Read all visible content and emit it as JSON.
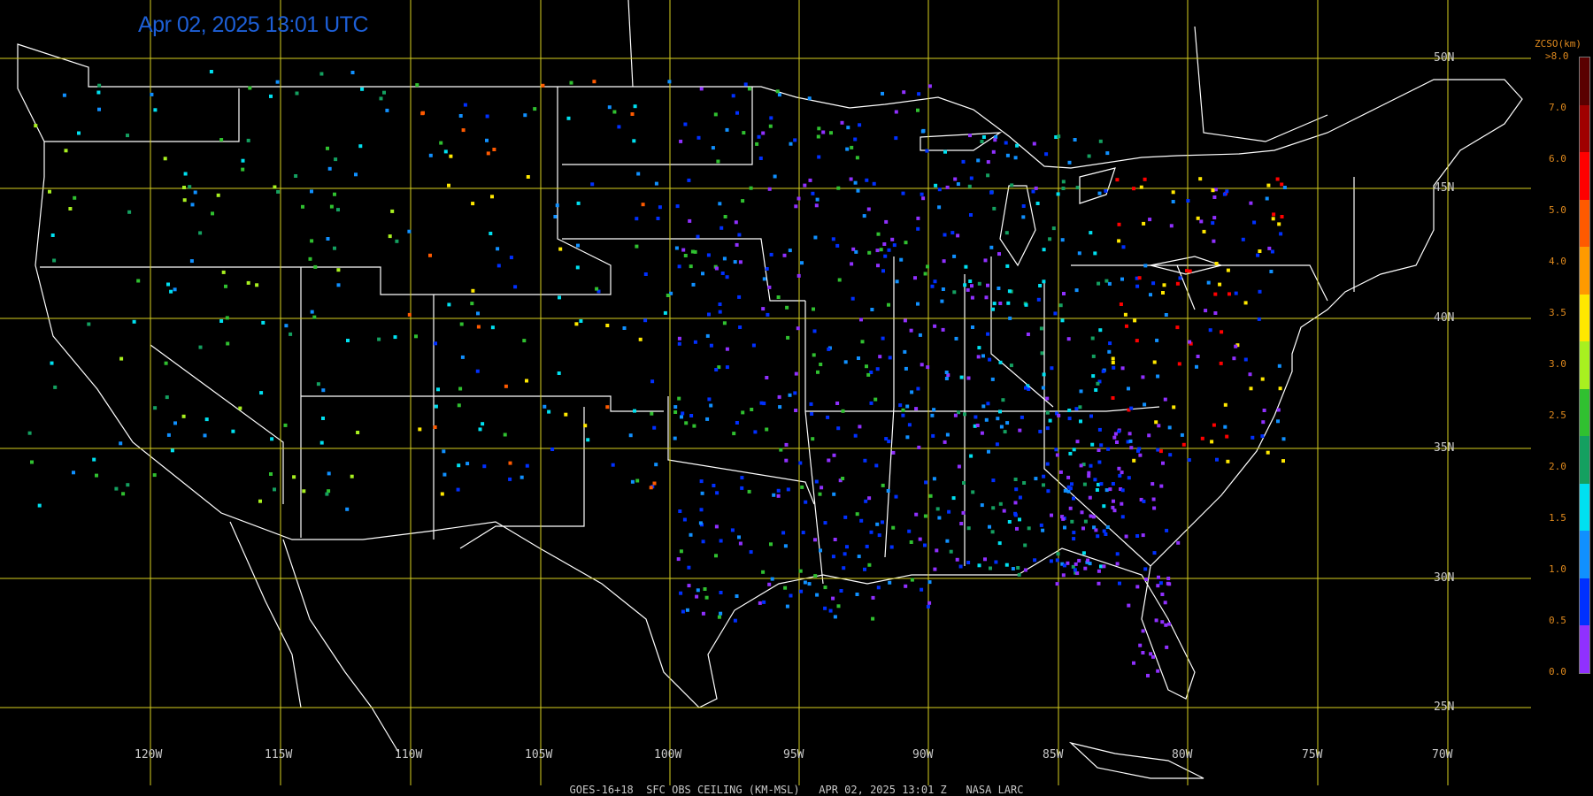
{
  "title": "Apr 02, 2025 13:01 UTC",
  "footer": "GOES-16+18  SFC OBS CEILING (KM-MSL)   APR 02, 2025 13:01 Z   NASA LARC",
  "legend": {
    "title": "ZCSO(km)",
    "top_label": ">8.0",
    "ticks": [
      "7.0",
      "6.0",
      "5.0",
      "4.0",
      "3.5",
      "3.0",
      "2.5",
      "2.0",
      "1.5",
      "1.0",
      "0.5",
      "0.0"
    ],
    "colors": [
      "#5a0000",
      "#a00000",
      "#ff0000",
      "#ff5a00",
      "#ff9a00",
      "#ffe800",
      "#a8f020",
      "#30c030",
      "#14a060",
      "#00e0f0",
      "#1090ff",
      "#0030ff",
      "#9030ff"
    ]
  },
  "latitudes": [
    "50N",
    "45N",
    "40N",
    "35N",
    "30N",
    "25N"
  ],
  "longitudes": [
    "120W",
    "115W",
    "110W",
    "105W",
    "100W",
    "95W",
    "90W",
    "85W",
    "80W",
    "75W",
    "70W"
  ],
  "colors": {
    "grid": "#d8d020",
    "boundaries": "#ffffff",
    "background": "#000000",
    "title": "#1d5fd6"
  }
}
